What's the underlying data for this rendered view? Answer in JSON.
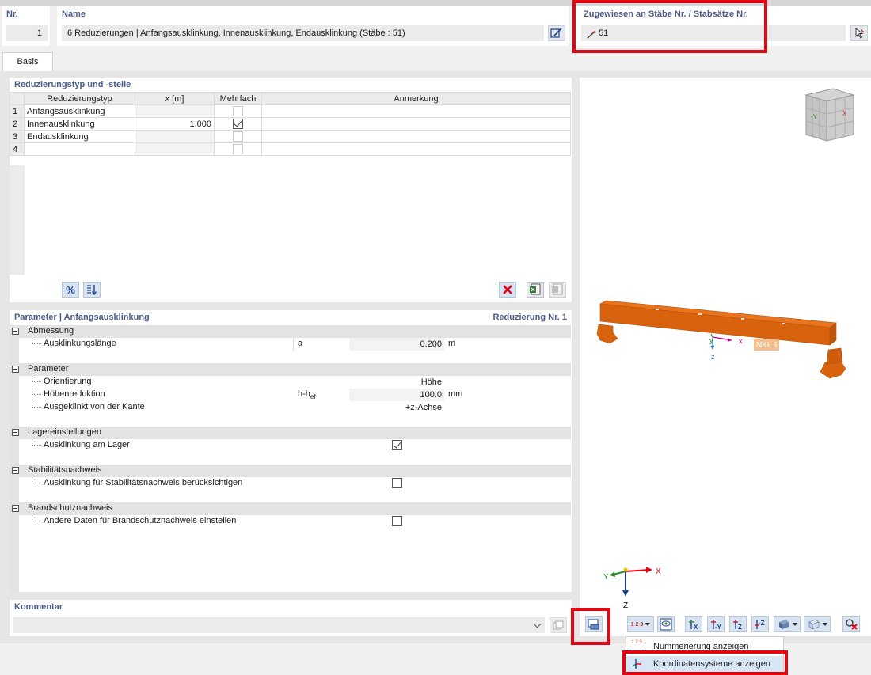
{
  "header": {
    "nr_label": "Nr.",
    "nr_value": "1",
    "name_label": "Name",
    "name_value": "6 Reduzierungen | Anfangsausklinkung, Innenausklinkung, Endausklinkung (Stäbe : 51)",
    "assigned_label": "Zugewiesen an Stäbe Nr. / Stabsätze Nr.",
    "assigned_value": "51"
  },
  "tabs": [
    {
      "label": "Basis"
    }
  ],
  "reduction_table": {
    "title": "Reduzierungstyp und -stelle",
    "columns": [
      "Reduzierungstyp",
      "x [m]",
      "Mehrfach",
      "Anmerkung"
    ],
    "rows": [
      {
        "nr": "1",
        "typ": "Anfangsausklinkung",
        "x": "",
        "mehrfach": false,
        "anmerkung": ""
      },
      {
        "nr": "2",
        "typ": "Innenausklinkung",
        "x": "1.000",
        "mehrfach": true,
        "anmerkung": ""
      },
      {
        "nr": "3",
        "typ": "Endausklinkung",
        "x": "",
        "mehrfach": false,
        "anmerkung": ""
      },
      {
        "nr": "4",
        "typ": "",
        "x": "",
        "mehrfach": false,
        "anmerkung": ""
      }
    ],
    "percent_button": "%"
  },
  "parameter": {
    "title": "Parameter | Anfangsausklinkung",
    "right_title": "Reduzierung Nr. 1",
    "groups": [
      {
        "label": "Abmessung",
        "rows": [
          {
            "label": "Ausklinkungslänge",
            "symbol": "a",
            "value": "0.200",
            "unit": "m"
          }
        ]
      },
      {
        "label": "Parameter",
        "rows": [
          {
            "label": "Orientierung",
            "symbol": "",
            "value": "Höhe",
            "unit": ""
          },
          {
            "label": "Höhenreduktion",
            "symbol": "h-h",
            "symbol_sub": "ef",
            "value": "100.0",
            "unit": "mm"
          },
          {
            "label": "Ausgeklinkt von der Kante",
            "symbol": "",
            "value": "+z-Achse",
            "unit": ""
          }
        ]
      },
      {
        "label": "Lagereinstellungen",
        "rows": [
          {
            "label": "Ausklinkung am Lager",
            "checked": true
          }
        ]
      },
      {
        "label": "Stabilitätsnachweis",
        "rows": [
          {
            "label": "Ausklinkung für Stabilitätsnachweis berücksichtigen",
            "checked": false
          }
        ]
      },
      {
        "label": "Brandschutznachweis",
        "rows": [
          {
            "label": "Andere Daten für Brandschutznachweis einstellen",
            "checked": false
          }
        ]
      }
    ]
  },
  "comment": {
    "label": "Kommentar",
    "value": ""
  },
  "viewport": {
    "beam_label": "NKL 1",
    "local_axes": {
      "x": "x",
      "y": "y",
      "z": "z"
    },
    "global_axes": {
      "x": "X",
      "y": "Y",
      "z": "Z"
    },
    "cube_labels": {
      "y": "-Y",
      "x": "X"
    }
  },
  "toolbar": {
    "numbering_glyph": "1 2 3"
  },
  "dropdown_menu": {
    "items": [
      {
        "label": "Nummerierung anzeigen"
      },
      {
        "label": "Koordinatensysteme anzeigen"
      }
    ]
  },
  "colors": {
    "accent": "#4a5b8a",
    "highlight": "#e30613",
    "beam": "#d9620e",
    "grid_header": "#ebebeb"
  }
}
